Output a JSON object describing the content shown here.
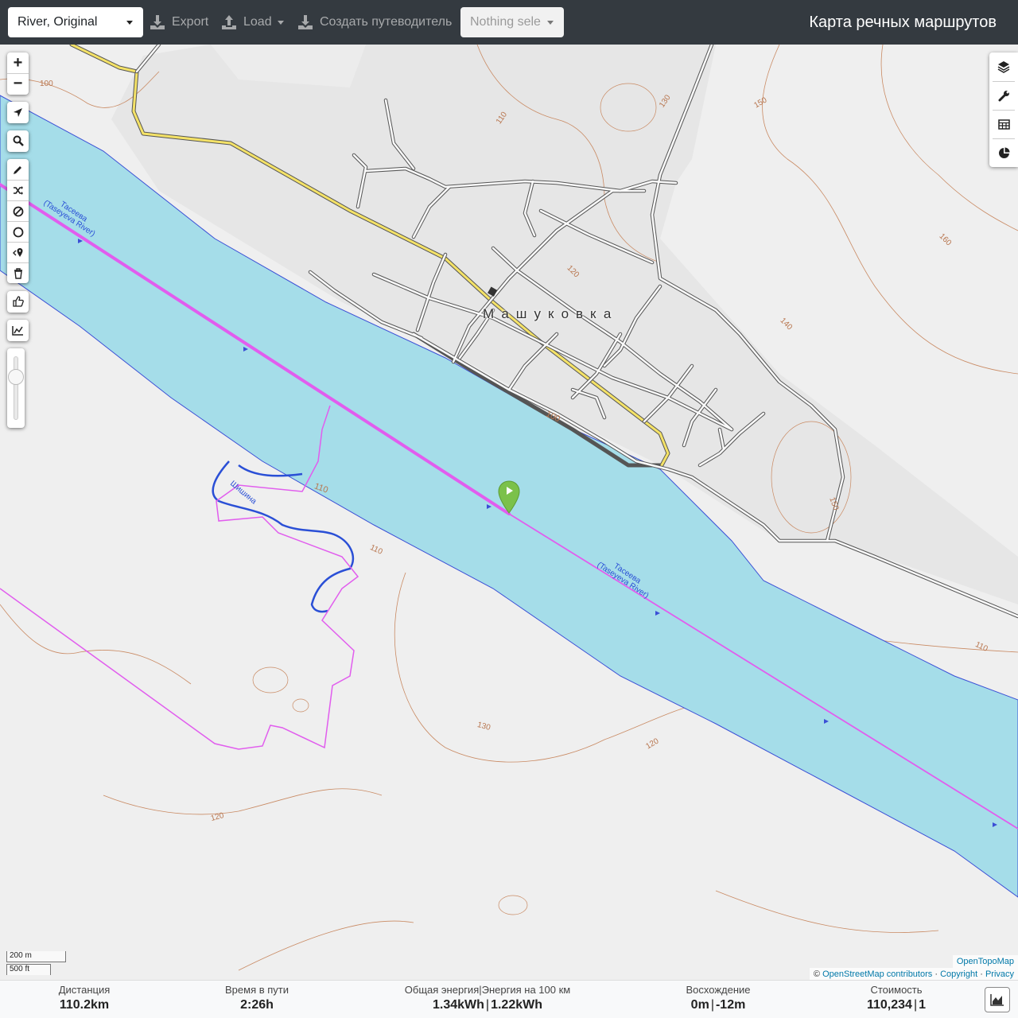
{
  "header": {
    "profile_select": "River, Original",
    "export_label": "Export",
    "load_label": "Load",
    "guide_label": "Создать путеводитель",
    "segment_select": "Nothing sele",
    "app_title": "Карта речных маршрутов"
  },
  "map": {
    "village_label": "Машуковка",
    "river_label": "Тасеева",
    "river_label_latin": "(Taseyeva River)",
    "stream_label": "Шишина",
    "contours": [
      "100",
      "110",
      "130",
      "150",
      "120",
      "160",
      "140",
      "100",
      "110",
      "130",
      "120",
      "120",
      "150",
      "110",
      "110"
    ]
  },
  "controls": {
    "left": [
      "zoom-in-button",
      "zoom-out-button",
      "locate-button",
      "search-button",
      "draw-button",
      "reverse-button",
      "delete-route-button",
      "circle-button",
      "poi-button",
      "clear-button",
      "hand-button",
      "elevation-button"
    ],
    "right": [
      "layers-button",
      "settings-button",
      "table-button",
      "stats-button"
    ]
  },
  "scale": {
    "metric": "200 m",
    "imperial": "500 ft"
  },
  "attribution": {
    "layer": "OpenTopoMap",
    "copyright_sign": "©",
    "osm": "OpenStreetMap contributors",
    "copyright": "Copyright",
    "privacy": "Privacy",
    "sep": "·"
  },
  "stats": {
    "distance_label": "Дистанция",
    "distance_value": "110.2",
    "distance_unit": "km",
    "time_label": "Время в пути",
    "time_value": "2:26",
    "time_unit": "h",
    "energy_label": "Общая энергия",
    "energy_sep": "|",
    "energy100_label": "Энергия на 100 км",
    "energy_value": "1.34",
    "energy_unit": "kWh",
    "energy100_value": "1.22",
    "energy100_unit": "kWh",
    "ascent_label": "Восхождение",
    "ascent_value": "0",
    "ascent_unit": "m",
    "descent_value": "-12",
    "descent_unit": "m",
    "cost_label": "Стоимость",
    "cost_value": "110,234",
    "cost_extra": "1"
  },
  "colors": {
    "river": "#a5dde9",
    "route": "#e15dee",
    "road_main": "#f4e267",
    "contour": "#c98a63",
    "stream": "#2a4fd6",
    "marker": "#7bc14a"
  }
}
